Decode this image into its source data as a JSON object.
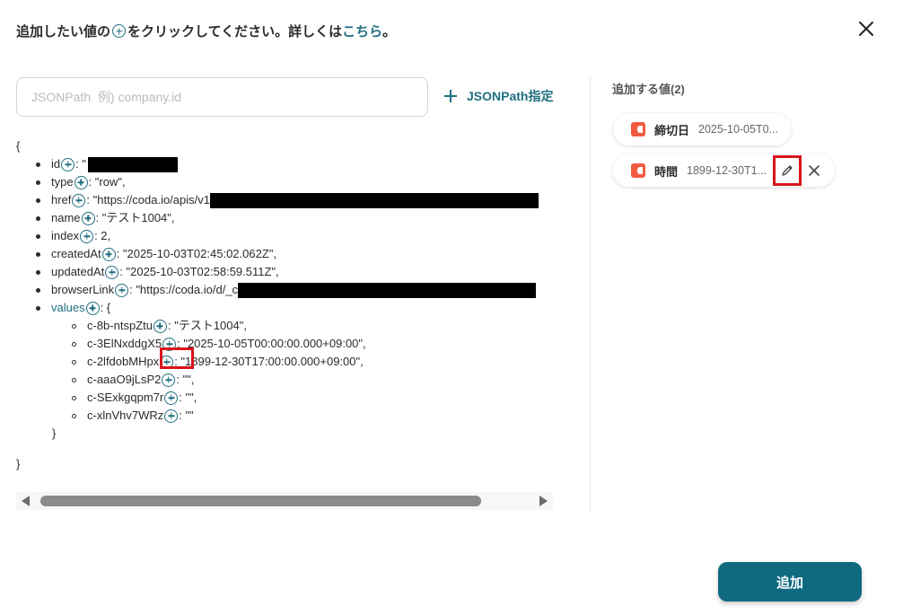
{
  "header": {
    "instruction_before": "追加したい値の",
    "instruction_after": "をクリックしてください。詳しくは",
    "link_text": "こちら",
    "instruction_end": "。"
  },
  "search": {
    "placeholder": "JSONPath  例) company.id",
    "value": ""
  },
  "jsonpath_button": {
    "label": "JSONPath指定"
  },
  "tree": {
    "open_brace": "{",
    "close_brace": "}",
    "values_close": "}",
    "items": [
      {
        "key": "id",
        "value": ": \""
      },
      {
        "key": "type",
        "value": ": \"row\","
      },
      {
        "key": "href",
        "value": ": \"https://coda.io/apis/v1"
      },
      {
        "key": "name",
        "value": ": \"テスト1004\","
      },
      {
        "key": "index",
        "value": ": 2,"
      },
      {
        "key": "createdAt",
        "value": ": \"2025-10-03T02:45:02.062Z\","
      },
      {
        "key": "updatedAt",
        "value": ": \"2025-10-03T02:58:59.511Z\","
      },
      {
        "key": "browserLink",
        "value": ": \"https://coda.io/d/_c"
      },
      {
        "key": "values",
        "value": ": {"
      }
    ],
    "values": [
      {
        "key": "c-8b-ntspZtu",
        "value": ": \"テスト1004\","
      },
      {
        "key": "c-3ElNxddgX5",
        "value": ": \"2025-10-05T00:00:00.000+09:00\","
      },
      {
        "key": "c-2lfdobMHpx",
        "value": ": \"1899-12-30T17:00:00.000+09:00\","
      },
      {
        "key": "c-aaaO9jLsP2",
        "value": ": \"\","
      },
      {
        "key": "c-SExkgqpm7r",
        "value": ": \"\","
      },
      {
        "key": "c-xlnVhv7WRz",
        "value": ": \"\""
      }
    ]
  },
  "right_panel": {
    "title": "追加する値(2)",
    "chips": [
      {
        "label": "締切日",
        "value": "2025-10-05T0..."
      },
      {
        "label": "時間",
        "value": "1899-12-30T1..."
      }
    ]
  },
  "footer": {
    "add_button": "追加"
  },
  "colors": {
    "accent": "#1f6e80",
    "button": "#0f6a80",
    "highlight": "#d8141c",
    "app_icon": "#f05a3f"
  },
  "icons": [
    "plus-circle-icon",
    "close-icon",
    "plus-icon",
    "coda-app-icon",
    "pencil-icon",
    "remove-icon"
  ]
}
